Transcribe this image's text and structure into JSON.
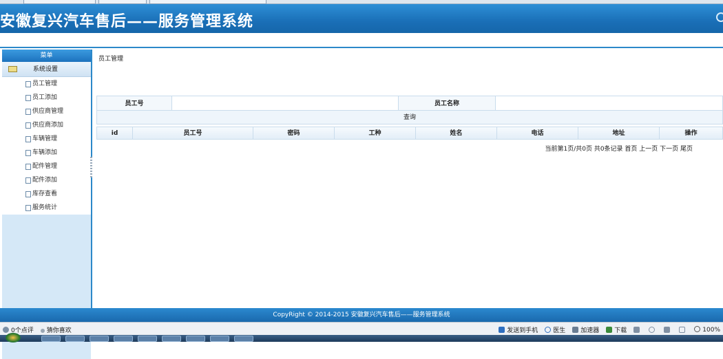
{
  "header": {
    "title": "安徽复兴汽车售后——服务管理系统"
  },
  "sidebar": {
    "menu_title": "菜单",
    "group": "系统设置",
    "items": [
      "员工管理",
      "员工添加",
      "供应商管理",
      "供应商添加",
      "车辆管理",
      "车辆添加",
      "配件管理",
      "配件添加",
      "库存查看",
      "服务统计"
    ]
  },
  "main": {
    "breadcrumb": "员工管理",
    "search": {
      "label1": "员工号",
      "label2": "员工名称",
      "query_button": "查询"
    },
    "columns": [
      "id",
      "员工号",
      "密码",
      "工种",
      "姓名",
      "电话",
      "地址",
      "操作"
    ],
    "pager": "当前第1页/共0页  共0条记录   首页 上一页 下一页 尾页"
  },
  "footer": {
    "copyright": "CopyRight © 2014-2015 安徽复兴汽车售后——服务管理系统"
  },
  "statusbar": {
    "comments": "0个点评",
    "guess": "猜你喜欢",
    "send_phone": "发送到手机",
    "doctor": "医生",
    "accelerator": "加速器",
    "download": "下载",
    "zoom": "100%"
  }
}
